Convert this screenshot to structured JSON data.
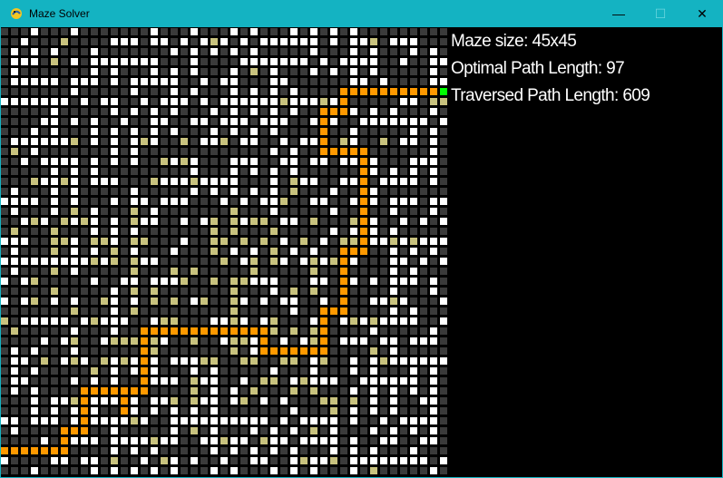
{
  "window": {
    "title": "Maze Solver",
    "app_icon": "python-snake-icon"
  },
  "controls": {
    "minimize": "—",
    "maximize": "☐",
    "close": "✕"
  },
  "info": {
    "maze_size": "Maze size: 45x45",
    "optimal_path": "Optimal Path Length: 97",
    "traversed_path": "Traversed Path Length: 609"
  },
  "maze": {
    "size": 45,
    "colors": {
      "wall": "#3a3a3a",
      "open": "#ffffff",
      "visited": "#c8c27e",
      "path": "#ff9900",
      "start": "#00ff00"
    },
    "goal_cell": [
      44,
      6
    ]
  }
}
